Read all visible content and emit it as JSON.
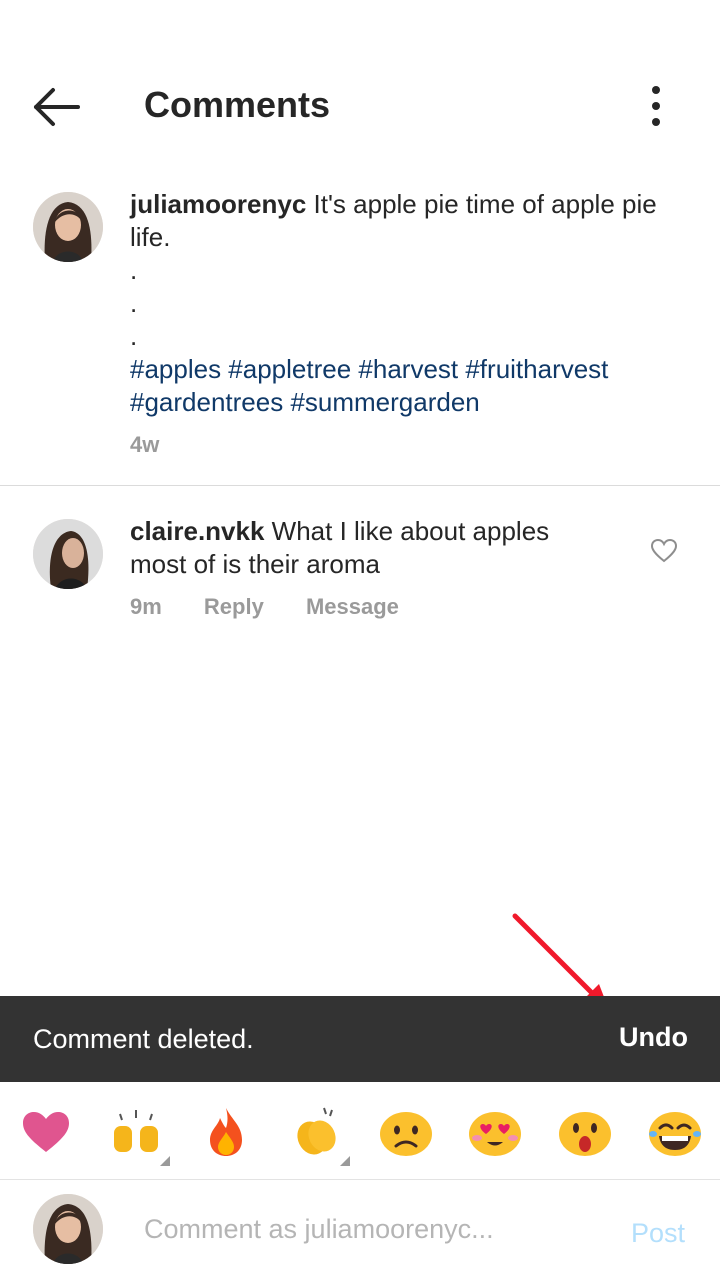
{
  "header": {
    "title": "Comments",
    "back_icon": "arrow-left-icon",
    "more_icon": "more-vertical-icon"
  },
  "caption": {
    "username": "juliamoorenyc",
    "text": "It's apple pie time of apple pie life.",
    "dots": [
      ".",
      ".",
      "."
    ],
    "hashtags": "#apples #appletree #harvest #fruitharvest #gardentrees #summergarden",
    "time": "4w"
  },
  "comment": {
    "username": "claire.nvkk",
    "text": "What I like about apples most of is their aroma",
    "time": "9m",
    "reply_label": "Reply",
    "message_label": "Message"
  },
  "snackbar": {
    "message": "Comment deleted.",
    "action_label": "Undo"
  },
  "emojis": [
    "heart",
    "raising-hands",
    "fire",
    "clapping-hands",
    "sad-face",
    "heart-eyes-face",
    "surprised-face",
    "laughing-face"
  ],
  "composer": {
    "placeholder": "Comment as juliamoorenyc...",
    "post_label": "Post"
  },
  "colors": {
    "hashtag": "#103968",
    "snackbar_bg": "#333333",
    "post_disabled": "#b3dffc",
    "annotation_arrow": "#f0192b"
  }
}
